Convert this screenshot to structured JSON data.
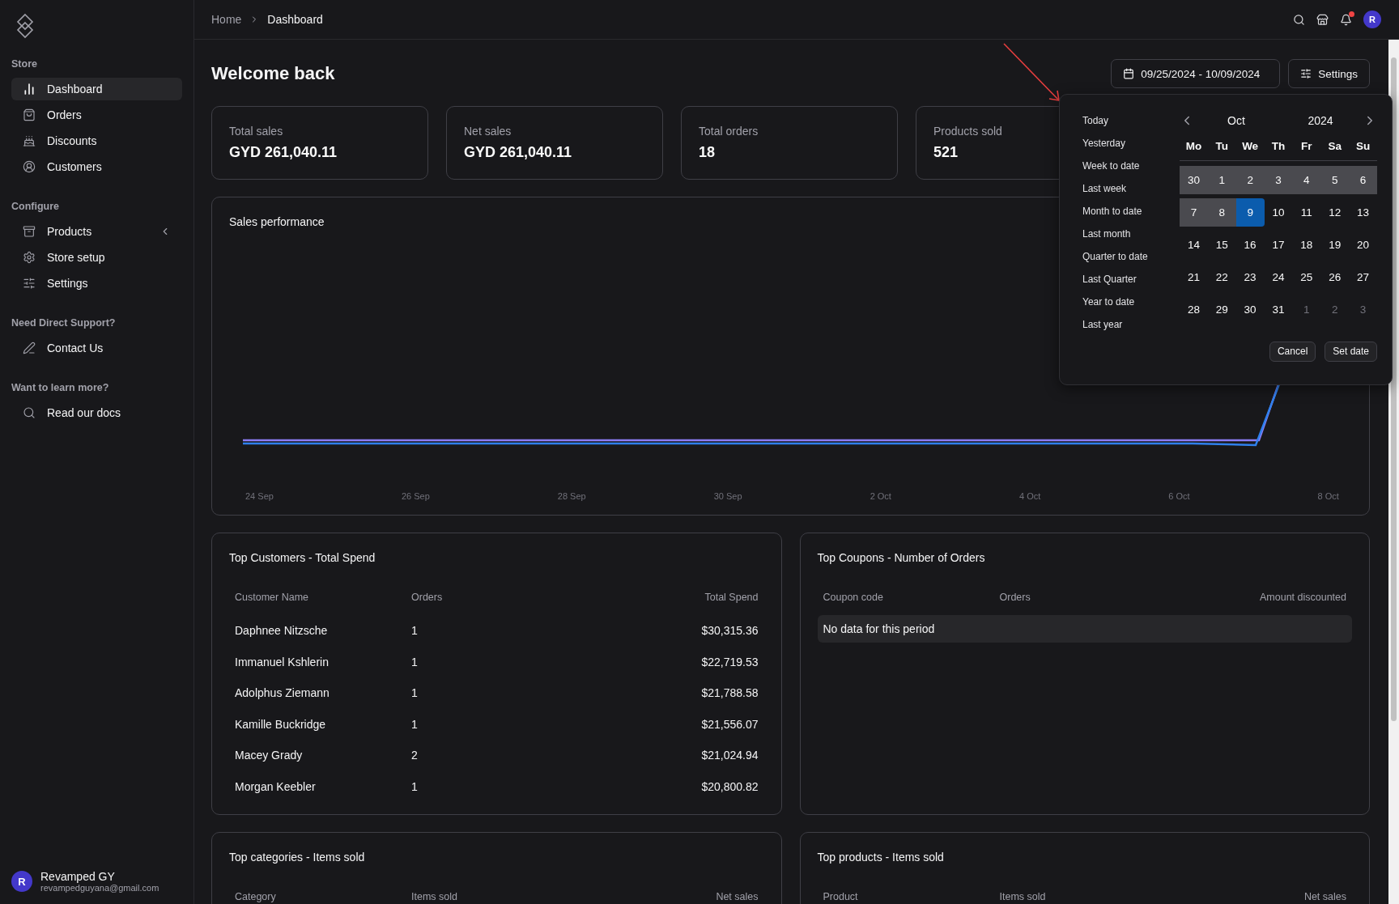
{
  "sidebar": {
    "sections": [
      {
        "title": "Store",
        "items": [
          {
            "label": "Dashboard",
            "selected": true,
            "submenu": false
          },
          {
            "label": "Orders",
            "selected": false,
            "submenu": false
          },
          {
            "label": "Discounts",
            "selected": false,
            "submenu": false
          },
          {
            "label": "Customers",
            "selected": false,
            "submenu": false
          }
        ]
      },
      {
        "title": "Configure",
        "items": [
          {
            "label": "Products",
            "selected": false,
            "submenu": true
          },
          {
            "label": "Store setup",
            "selected": false,
            "submenu": false
          },
          {
            "label": "Settings",
            "selected": false,
            "submenu": false
          }
        ]
      },
      {
        "title": "Need Direct Support?",
        "items": [
          {
            "label": "Contact Us",
            "selected": false,
            "submenu": false
          }
        ]
      },
      {
        "title": "Want to learn more?",
        "items": [
          {
            "label": "Read our docs",
            "selected": false,
            "submenu": false
          }
        ]
      }
    ],
    "user": {
      "initial": "R",
      "name": "Revamped GY",
      "email": "revampedguyana@gmail.com"
    }
  },
  "header": {
    "breadcrumb": [
      "Home",
      "Dashboard"
    ],
    "avatar_initial": "R",
    "unread_notifications": true
  },
  "page": {
    "title": "Welcome back",
    "date_range": "09/25/2024 - 10/09/2024",
    "settings_label": "Settings"
  },
  "stats": [
    {
      "label": "Total sales",
      "value": "GYD 261,040.11"
    },
    {
      "label": "Net sales",
      "value": "GYD 261,040.11"
    },
    {
      "label": "Total orders",
      "value": "18"
    },
    {
      "label": "Products sold",
      "value": "521"
    }
  ],
  "sales_performance": {
    "title": "Sales performance",
    "x_labels": [
      "24 Sep",
      "26 Sep",
      "28 Sep",
      "30 Sep",
      "2 Oct",
      "4 Oct",
      "6 Oct",
      "8 Oct"
    ]
  },
  "top_customers": {
    "title": "Top Customers - Total Spend",
    "columns": [
      "Customer Name",
      "Orders",
      "Total Spend"
    ],
    "rows": [
      [
        "Daphnee Nitzsche",
        "1",
        "$30,315.36"
      ],
      [
        "Immanuel Kshlerin",
        "1",
        "$22,719.53"
      ],
      [
        "Adolphus Ziemann",
        "1",
        "$21,788.58"
      ],
      [
        "Kamille Buckridge",
        "1",
        "$21,556.07"
      ],
      [
        "Macey Grady",
        "2",
        "$21,024.94"
      ],
      [
        "Morgan Keebler",
        "1",
        "$20,800.82"
      ]
    ]
  },
  "top_coupons": {
    "title": "Top Coupons - Number of Orders",
    "columns": [
      "Coupon code",
      "Orders",
      "Amount discounted"
    ],
    "empty_message": "No data for this period"
  },
  "top_categories": {
    "title": "Top categories - Items sold",
    "columns": [
      "Category",
      "Items sold",
      "Net sales"
    ]
  },
  "top_products": {
    "title": "Top products - Items sold",
    "columns": [
      "Product",
      "Items sold",
      "Net sales"
    ]
  },
  "date_picker": {
    "presets": [
      "Today",
      "Yesterday",
      "Week to date",
      "Last week",
      "Month to date",
      "Last month",
      "Quarter to date",
      "Last Quarter",
      "Year to date",
      "Last year"
    ],
    "month": "Oct",
    "year": "2024",
    "weekdays": [
      "Mo",
      "Tu",
      "We",
      "Th",
      "Fr",
      "Sa",
      "Su"
    ],
    "weeks": [
      [
        {
          "day": "30",
          "in_range": true,
          "selected": false,
          "outside": false
        },
        {
          "day": "1",
          "in_range": true,
          "selected": false,
          "outside": false
        },
        {
          "day": "2",
          "in_range": true,
          "selected": false,
          "outside": false
        },
        {
          "day": "3",
          "in_range": true,
          "selected": false,
          "outside": false
        },
        {
          "day": "4",
          "in_range": true,
          "selected": false,
          "outside": false
        },
        {
          "day": "5",
          "in_range": true,
          "selected": false,
          "outside": false
        },
        {
          "day": "6",
          "in_range": true,
          "selected": false,
          "outside": false
        }
      ],
      [
        {
          "day": "7",
          "in_range": true,
          "selected": false,
          "outside": false
        },
        {
          "day": "8",
          "in_range": true,
          "selected": false,
          "outside": false
        },
        {
          "day": "9",
          "in_range": false,
          "selected": true,
          "outside": false
        },
        {
          "day": "10",
          "in_range": false,
          "selected": false,
          "outside": false
        },
        {
          "day": "11",
          "in_range": false,
          "selected": false,
          "outside": false
        },
        {
          "day": "12",
          "in_range": false,
          "selected": false,
          "outside": false
        },
        {
          "day": "13",
          "in_range": false,
          "selected": false,
          "outside": false
        }
      ],
      [
        {
          "day": "14",
          "in_range": false,
          "selected": false,
          "outside": false
        },
        {
          "day": "15",
          "in_range": false,
          "selected": false,
          "outside": false
        },
        {
          "day": "16",
          "in_range": false,
          "selected": false,
          "outside": false
        },
        {
          "day": "17",
          "in_range": false,
          "selected": false,
          "outside": false
        },
        {
          "day": "18",
          "in_range": false,
          "selected": false,
          "outside": false
        },
        {
          "day": "19",
          "in_range": false,
          "selected": false,
          "outside": false
        },
        {
          "day": "20",
          "in_range": false,
          "selected": false,
          "outside": false
        }
      ],
      [
        {
          "day": "21",
          "in_range": false,
          "selected": false,
          "outside": false
        },
        {
          "day": "22",
          "in_range": false,
          "selected": false,
          "outside": false
        },
        {
          "day": "23",
          "in_range": false,
          "selected": false,
          "outside": false
        },
        {
          "day": "24",
          "in_range": false,
          "selected": false,
          "outside": false
        },
        {
          "day": "25",
          "in_range": false,
          "selected": false,
          "outside": false
        },
        {
          "day": "26",
          "in_range": false,
          "selected": false,
          "outside": false
        },
        {
          "day": "27",
          "in_range": false,
          "selected": false,
          "outside": false
        }
      ],
      [
        {
          "day": "28",
          "in_range": false,
          "selected": false,
          "outside": false
        },
        {
          "day": "29",
          "in_range": false,
          "selected": false,
          "outside": false
        },
        {
          "day": "30",
          "in_range": false,
          "selected": false,
          "outside": false
        },
        {
          "day": "31",
          "in_range": false,
          "selected": false,
          "outside": false
        },
        {
          "day": "1",
          "in_range": false,
          "selected": false,
          "outside": true
        },
        {
          "day": "2",
          "in_range": false,
          "selected": false,
          "outside": true
        },
        {
          "day": "3",
          "in_range": false,
          "selected": false,
          "outside": true
        }
      ]
    ],
    "cancel_label": "Cancel",
    "confirm_label": "Set date"
  }
}
